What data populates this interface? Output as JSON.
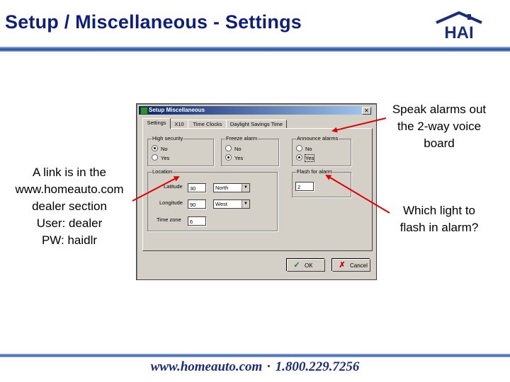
{
  "slide": {
    "title": "Setup / Miscellaneous - Settings",
    "logo_text": "HAI",
    "footer_site": "www.homeauto.com",
    "footer_separator": "·",
    "footer_phone": "1.800.229.7256"
  },
  "annotations": {
    "left_lines": [
      "A link is in the",
      "www.homeauto.com",
      "dealer section",
      "User: dealer",
      "PW: haidlr"
    ],
    "speak_lines": [
      "Speak alarms out",
      "the 2-way voice",
      "board"
    ],
    "flash_lines": [
      "Which light to",
      "flash in alarm?"
    ]
  },
  "dialog": {
    "title": "Setup Miscellaneous",
    "close_glyph": "✕",
    "tabs": [
      "Settings",
      "X10",
      "Time Clocks",
      "Daylight Savings Time"
    ],
    "groups": {
      "high_security": {
        "label": "High security",
        "options": [
          "No",
          "Yes"
        ]
      },
      "freeze_alarm": {
        "label": "Freeze alarm",
        "options": [
          "No",
          "Yes"
        ]
      },
      "announce_alarms": {
        "label": "Announce alarms",
        "options": [
          "No",
          "Yes"
        ]
      },
      "location": {
        "label": "Location",
        "latitude_label": "Latitude",
        "latitude_value": "30",
        "latitude_dir": "North",
        "longitude_label": "Longitude",
        "longitude_value": "90",
        "longitude_dir": "West",
        "timezone_label": "Time zone",
        "timezone_value": "6"
      },
      "flash_for_alarm": {
        "label": "Flash for alarm",
        "value": "2"
      }
    },
    "buttons": {
      "ok_label": "OK",
      "cancel_label": "Cancel"
    }
  },
  "colors": {
    "title_blue": "#0e1f7a",
    "rule_blue": "#2a4e9a",
    "arrow_red": "#e00000",
    "dialog_gray": "#d4d0c8"
  }
}
